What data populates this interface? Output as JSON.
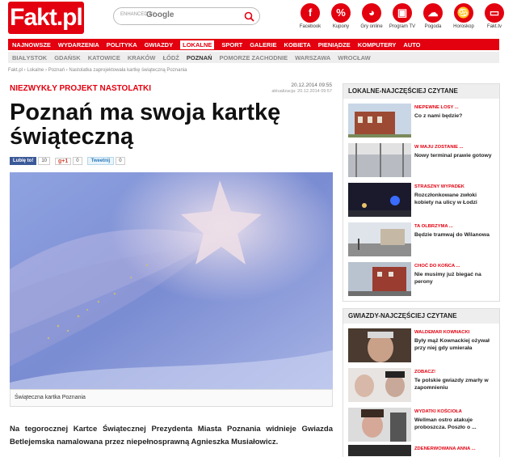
{
  "header": {
    "logo": "Fakt.pl",
    "search": {
      "placeholder": "ENHANCED BY",
      "engine": "Google"
    },
    "icons": [
      {
        "name": "facebook-icon",
        "glyph": "f",
        "label": "Facebook"
      },
      {
        "name": "coupon-icon",
        "glyph": "%",
        "label": "Kupony"
      },
      {
        "name": "games-icon",
        "glyph": "◕",
        "label": "Gry online"
      },
      {
        "name": "tv-program-icon",
        "glyph": "▣",
        "label": "Program TV"
      },
      {
        "name": "weather-icon",
        "glyph": "☁",
        "label": "Pogoda"
      },
      {
        "name": "horoscope-icon",
        "glyph": "♋",
        "label": "Horoskop"
      },
      {
        "name": "fakt-tv-icon",
        "glyph": "▭",
        "label": "Fakt.tv"
      }
    ]
  },
  "nav": {
    "items": [
      "NAJNOWSZE",
      "WYDARZENIA",
      "POLITYKA",
      "GWIAZDY",
      "LOKALNE",
      "SPORT",
      "GALERIE",
      "KOBIETA",
      "PIENIĄDZE",
      "KOMPUTERY",
      "AUTO"
    ],
    "active": "LOKALNE"
  },
  "subnav": {
    "items": [
      "BIAŁYSTOK",
      "GDAŃSK",
      "KATOWICE",
      "KRAKÓW",
      "ŁÓDŹ",
      "POZNAŃ",
      "POMORZE ZACHODNIE",
      "WARSZAWA",
      "WROCŁAW"
    ],
    "active": "POZNAŃ"
  },
  "breadcrumb": "Fakt.pl › Lokalne › Poznań › Nastolatka zaprojektowała kartkę świąteczną Poznania",
  "article": {
    "kicker": "NIEZWYKŁY PROJEKT NASTOLATKI",
    "date": "20.12.2014 09:55",
    "updated": "aktualizacja: 20.12.2014 09:57",
    "headline": "Poznań ma swoja kartkę świąteczną",
    "social": {
      "fb_label": "Lubię to!",
      "fb_count": "10",
      "gplus_label": "g+1",
      "gplus_count": "0",
      "tweet_label": "Tweetnij",
      "tweet_count": "0"
    },
    "caption": "Świąteczna kartka Poznania",
    "lead": "Na tegorocznej Kartce Świątecznej Prezydenta Miasta Poznania widnieje Gwiazda Betlejemska namalowana przez niepełnosprawną Agnieszka Musiałowicz."
  },
  "sidebar": {
    "local": {
      "title": "LOKALNE-NAJCZĘŚCIEJ CZYTANE",
      "items": [
        {
          "category": "NIEPEWNE LOSY ...",
          "text": "Co z nami będzie?"
        },
        {
          "category": "W MAJU ZOSTANIE ...",
          "text": "Nowy terminal prawie gotowy"
        },
        {
          "category": "STRASZNY WYPADEK",
          "text": "Rozczłonkowane zwłoki kobiety na ulicy w Łodzi"
        },
        {
          "category": "TA OLBRZYMA ...",
          "text": "Będzie tramwaj do Wilanowa"
        },
        {
          "category": "CHOĆ DO KOŃCA ...",
          "text": "Nie musimy już biegać na perony"
        }
      ]
    },
    "stars": {
      "title": "GWIAZDY-NAJCZĘŚCIEJ CZYTANE",
      "items": [
        {
          "category": "WALDEMAR KOWNACKI",
          "text": "Były mąż Kownackiej ożywał przy niej gdy umierała"
        },
        {
          "category": "ZOBACZ!",
          "text": "Te polskie gwiazdy zmarły w zapomnieniu"
        },
        {
          "category": "WYDATKI KOŚCIOŁA",
          "text": "Wellman ostro atakuje proboszcza. Poszło o ..."
        },
        {
          "category": "ZDENERWOWANA ANNA ...",
          "text": ""
        }
      ]
    }
  },
  "colors": {
    "brand": "#e3000f",
    "sky": "#7d8fd6"
  }
}
